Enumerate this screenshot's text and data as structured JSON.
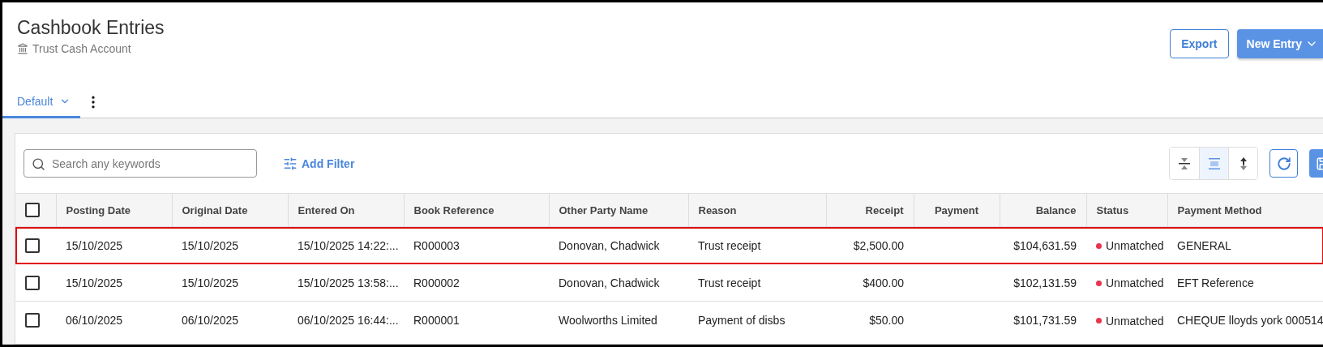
{
  "header": {
    "title": "Cashbook Entries",
    "subtitle": "Trust Cash Account"
  },
  "actions": {
    "export": "Export",
    "new_entry": "New Entry"
  },
  "tabs": [
    {
      "label": "Default",
      "selected": true
    }
  ],
  "toolbar": {
    "search": {
      "placeholder": "Search any keywords"
    },
    "add_filter": "Add Filter",
    "density": [
      {
        "selected": false
      },
      {
        "selected": true
      },
      {
        "selected": false
      }
    ]
  },
  "table": {
    "select_all": {
      "checked": false
    },
    "columns": [
      "Posting Date",
      "Original Date",
      "Entered On",
      "Book Reference",
      "Other Party Name",
      "Reason",
      "Receipt",
      "Payment",
      "Balance",
      "Status",
      "Payment Method"
    ],
    "rows": [
      {
        "checked": false,
        "highlighted": true,
        "cells": [
          "15/10/2025",
          "15/10/2025",
          "15/10/2025 14:22:...",
          "R000003",
          "Donovan, Chadwick",
          "Trust receipt",
          "$2,500.00",
          "",
          "$104,631.59",
          "Unmatched",
          "GENERAL"
        ]
      },
      {
        "checked": false,
        "highlighted": false,
        "cells": [
          "15/10/2025",
          "15/10/2025",
          "15/10/2025 13:58:...",
          "R000002",
          "Donovan, Chadwick",
          "Trust receipt",
          "$400.00",
          "",
          "$102,131.59",
          "Unmatched",
          "EFT Reference"
        ]
      },
      {
        "checked": false,
        "highlighted": false,
        "cells": [
          "06/10/2025",
          "06/10/2025",
          "06/10/2025 16:44:...",
          "R000001",
          "Woolworths Limited",
          "Payment of disbs",
          "$50.00",
          "",
          "$101,731.59",
          "Unmatched",
          "CHEQUE lloyds york 000514"
        ]
      }
    ]
  }
}
